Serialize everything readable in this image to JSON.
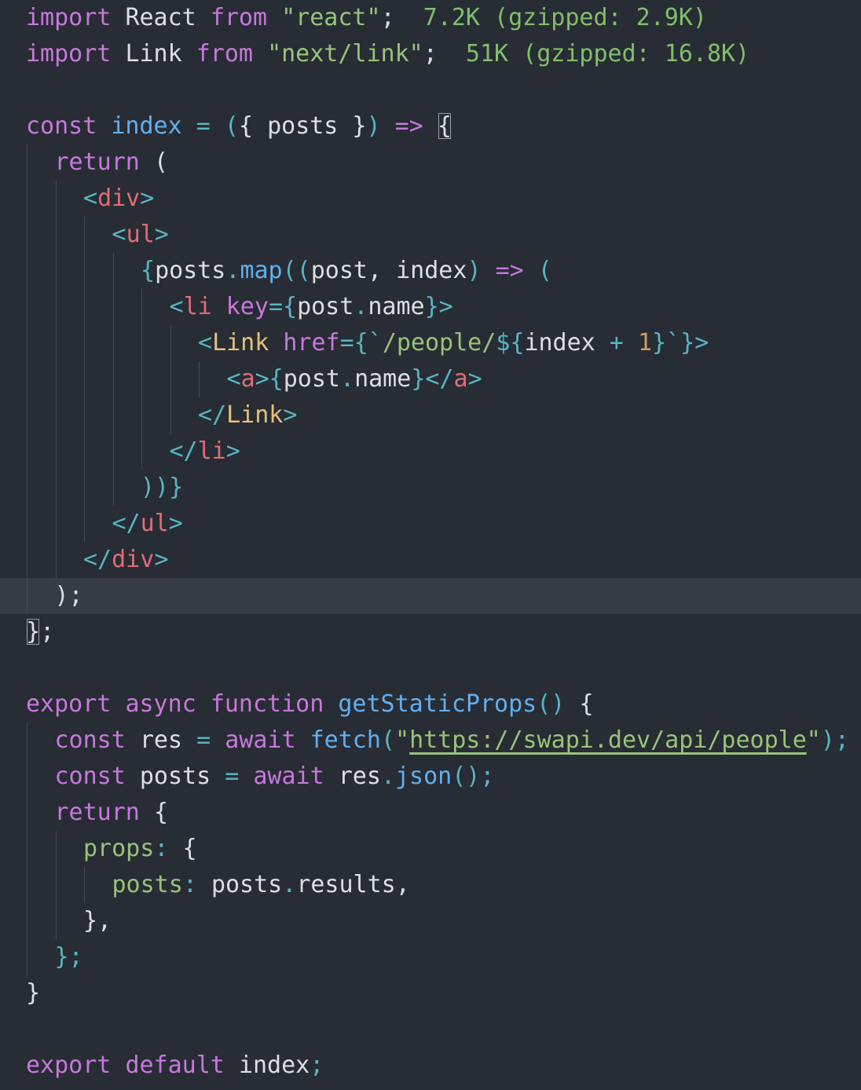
{
  "editor": {
    "active_line": 16,
    "lines": [
      {
        "indent": 0,
        "tokens": [
          {
            "t": "import ",
            "c": "kw"
          },
          {
            "t": "React ",
            "c": "plain"
          },
          {
            "t": "from ",
            "c": "kw"
          },
          {
            "t": "\"react\"",
            "c": "str"
          },
          {
            "t": ";",
            "c": "plain"
          },
          {
            "t": "  7.2K (gzipped: 2.9K)",
            "c": "hint"
          }
        ]
      },
      {
        "indent": 0,
        "tokens": [
          {
            "t": "import ",
            "c": "kw"
          },
          {
            "t": "Link ",
            "c": "plain"
          },
          {
            "t": "from ",
            "c": "kw"
          },
          {
            "t": "\"next/link\"",
            "c": "str"
          },
          {
            "t": ";",
            "c": "plain"
          },
          {
            "t": "  51K (gzipped: 16.8K)",
            "c": "hint"
          }
        ]
      },
      {
        "indent": 0,
        "tokens": []
      },
      {
        "indent": 0,
        "tokens": [
          {
            "t": "const ",
            "c": "kw"
          },
          {
            "t": "index",
            "c": "fn"
          },
          {
            "t": " = ",
            "c": "op"
          },
          {
            "t": "(",
            "c": "op"
          },
          {
            "t": "{ ",
            "c": "plain"
          },
          {
            "t": "posts",
            "c": "plain"
          },
          {
            "t": " }",
            "c": "plain"
          },
          {
            "t": ") ",
            "c": "op"
          },
          {
            "t": "=> ",
            "c": "kw"
          },
          {
            "t": "{",
            "c": "plain",
            "b": true
          }
        ]
      },
      {
        "indent": 1,
        "tokens": [
          {
            "t": "return ",
            "c": "kw"
          },
          {
            "t": "(",
            "c": "plain"
          }
        ]
      },
      {
        "indent": 2,
        "tokens": [
          {
            "t": "<",
            "c": "op"
          },
          {
            "t": "div",
            "c": "tag"
          },
          {
            "t": ">",
            "c": "op"
          }
        ]
      },
      {
        "indent": 3,
        "tokens": [
          {
            "t": "<",
            "c": "op"
          },
          {
            "t": "ul",
            "c": "tag"
          },
          {
            "t": ">",
            "c": "op"
          }
        ]
      },
      {
        "indent": 4,
        "tokens": [
          {
            "t": "{",
            "c": "op"
          },
          {
            "t": "posts",
            "c": "plain"
          },
          {
            "t": ".",
            "c": "op"
          },
          {
            "t": "map",
            "c": "fn"
          },
          {
            "t": "((",
            "c": "op"
          },
          {
            "t": "post",
            "c": "plain"
          },
          {
            "t": ", ",
            "c": "plain"
          },
          {
            "t": "index",
            "c": "plain"
          },
          {
            "t": ") ",
            "c": "op"
          },
          {
            "t": "=> ",
            "c": "kw"
          },
          {
            "t": "(",
            "c": "op"
          }
        ]
      },
      {
        "indent": 5,
        "tokens": [
          {
            "t": "<",
            "c": "op"
          },
          {
            "t": "li ",
            "c": "tag"
          },
          {
            "t": "key",
            "c": "attr"
          },
          {
            "t": "={",
            "c": "op"
          },
          {
            "t": "post",
            "c": "plain"
          },
          {
            "t": ".",
            "c": "op"
          },
          {
            "t": "name",
            "c": "plain"
          },
          {
            "t": "}>",
            "c": "op"
          }
        ]
      },
      {
        "indent": 6,
        "tokens": [
          {
            "t": "<",
            "c": "op"
          },
          {
            "t": "Link ",
            "c": "comp"
          },
          {
            "t": "href",
            "c": "attr"
          },
          {
            "t": "={`",
            "c": "op"
          },
          {
            "t": "/people/",
            "c": "str"
          },
          {
            "t": "${",
            "c": "op"
          },
          {
            "t": "index",
            "c": "plain"
          },
          {
            "t": " + ",
            "c": "op"
          },
          {
            "t": "1",
            "c": "num"
          },
          {
            "t": "}`}>",
            "c": "op"
          }
        ]
      },
      {
        "indent": 7,
        "tokens": [
          {
            "t": "<",
            "c": "op"
          },
          {
            "t": "a",
            "c": "tag"
          },
          {
            "t": ">{",
            "c": "op"
          },
          {
            "t": "post",
            "c": "plain"
          },
          {
            "t": ".",
            "c": "op"
          },
          {
            "t": "name",
            "c": "plain"
          },
          {
            "t": "}</",
            "c": "op"
          },
          {
            "t": "a",
            "c": "tag"
          },
          {
            "t": ">",
            "c": "op"
          }
        ]
      },
      {
        "indent": 6,
        "tokens": [
          {
            "t": "</",
            "c": "op"
          },
          {
            "t": "Link",
            "c": "comp"
          },
          {
            "t": ">",
            "c": "op"
          }
        ]
      },
      {
        "indent": 5,
        "tokens": [
          {
            "t": "</",
            "c": "op"
          },
          {
            "t": "li",
            "c": "tag"
          },
          {
            "t": ">",
            "c": "op"
          }
        ]
      },
      {
        "indent": 4,
        "tokens": [
          {
            "t": "))}",
            "c": "op"
          }
        ]
      },
      {
        "indent": 3,
        "tokens": [
          {
            "t": "</",
            "c": "op"
          },
          {
            "t": "ul",
            "c": "tag"
          },
          {
            "t": ">",
            "c": "op"
          }
        ]
      },
      {
        "indent": 2,
        "tokens": [
          {
            "t": "</",
            "c": "op"
          },
          {
            "t": "div",
            "c": "tag"
          },
          {
            "t": ">",
            "c": "op"
          }
        ]
      },
      {
        "indent": 1,
        "tokens": [
          {
            "t": ");",
            "c": "plain"
          }
        ]
      },
      {
        "indent": 0,
        "tokens": [
          {
            "t": "}",
            "c": "plain",
            "b": true
          },
          {
            "t": ";",
            "c": "plain"
          }
        ]
      },
      {
        "indent": 0,
        "tokens": []
      },
      {
        "indent": 0,
        "tokens": [
          {
            "t": "export ",
            "c": "kw"
          },
          {
            "t": "async ",
            "c": "kw"
          },
          {
            "t": "function ",
            "c": "kw"
          },
          {
            "t": "getStaticProps",
            "c": "fn"
          },
          {
            "t": "() ",
            "c": "op"
          },
          {
            "t": "{",
            "c": "plain"
          }
        ]
      },
      {
        "indent": 1,
        "tokens": [
          {
            "t": "const ",
            "c": "kw"
          },
          {
            "t": "res",
            "c": "plain"
          },
          {
            "t": " = ",
            "c": "op"
          },
          {
            "t": "await ",
            "c": "kw"
          },
          {
            "t": "fetch",
            "c": "fn"
          },
          {
            "t": "(",
            "c": "op"
          },
          {
            "t": "\"",
            "c": "str"
          },
          {
            "t": "https://swapi.dev/api/people",
            "c": "link"
          },
          {
            "t": "\"",
            "c": "str"
          },
          {
            "t": ");",
            "c": "op"
          }
        ]
      },
      {
        "indent": 1,
        "tokens": [
          {
            "t": "const ",
            "c": "kw"
          },
          {
            "t": "posts",
            "c": "plain"
          },
          {
            "t": " = ",
            "c": "op"
          },
          {
            "t": "await ",
            "c": "kw"
          },
          {
            "t": "res",
            "c": "plain"
          },
          {
            "t": ".",
            "c": "op"
          },
          {
            "t": "json",
            "c": "fn"
          },
          {
            "t": "();",
            "c": "op"
          }
        ]
      },
      {
        "indent": 1,
        "tokens": [
          {
            "t": "return ",
            "c": "kw"
          },
          {
            "t": "{",
            "c": "plain"
          }
        ]
      },
      {
        "indent": 2,
        "tokens": [
          {
            "t": "props",
            "c": "str"
          },
          {
            "t": ": ",
            "c": "op"
          },
          {
            "t": "{",
            "c": "plain"
          }
        ]
      },
      {
        "indent": 3,
        "tokens": [
          {
            "t": "posts",
            "c": "str"
          },
          {
            "t": ": ",
            "c": "op"
          },
          {
            "t": "posts",
            "c": "plain"
          },
          {
            "t": ".",
            "c": "op"
          },
          {
            "t": "results",
            "c": "plain"
          },
          {
            "t": ",",
            "c": "plain"
          }
        ]
      },
      {
        "indent": 2,
        "tokens": [
          {
            "t": "},",
            "c": "plain"
          }
        ]
      },
      {
        "indent": 1,
        "tokens": [
          {
            "t": "};",
            "c": "op"
          }
        ]
      },
      {
        "indent": 0,
        "tokens": [
          {
            "t": "}",
            "c": "plain"
          }
        ]
      },
      {
        "indent": 0,
        "tokens": []
      },
      {
        "indent": 0,
        "tokens": [
          {
            "t": "export ",
            "c": "kw"
          },
          {
            "t": "default ",
            "c": "kw"
          },
          {
            "t": "index",
            "c": "plain"
          },
          {
            "t": ";",
            "c": "op"
          }
        ]
      }
    ]
  }
}
